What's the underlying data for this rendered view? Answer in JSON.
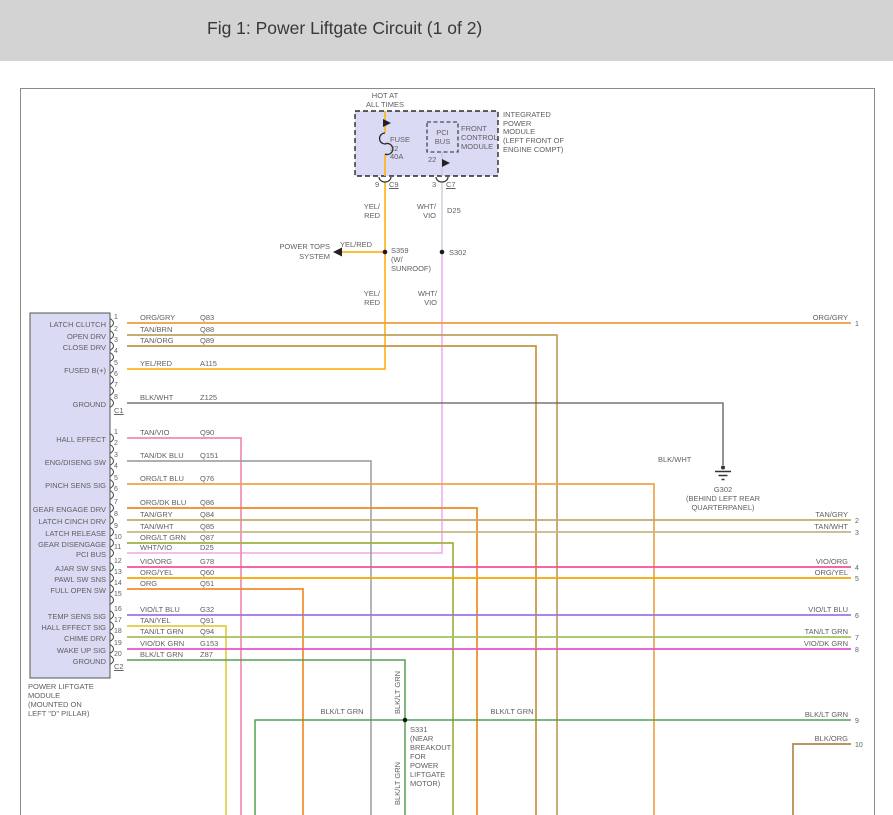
{
  "title": "Fig 1: Power Liftgate Circuit (1 of 2)",
  "colors": {
    "title_bar_bg": "#d3d3d3",
    "module_fill": "#dadaf4",
    "diagram_border": "#8a8a8a",
    "label_text": "#606060",
    "symbol_black": "#2b2b2b"
  },
  "wire_colors": {
    "ORG/GRY": "#F09C3C",
    "TAN/BRN": "#BFA05E",
    "TAN/ORG": "#C89440",
    "YEL/RED": "#FFB41E",
    "BLK/WHT": "#5C5C5C",
    "WHT/VIO_TOP": "#C9C9DB",
    "WHT/VIO": "#F2B4EC",
    "TAN/VIO": "#F08CB4",
    "TAN/DK BLU": "#9097A0",
    "ORG/LT BLU": "#F0A44C",
    "ORG/DK BLU": "#ED8A1F",
    "TAN/GRY": "#BCAD72",
    "TAN/WHT": "#C7B686",
    "ORG/LT GRN": "#9DB33F",
    "VIO/ORG": "#F24FA0",
    "ORG/YEL": "#F5A500",
    "ORG": "#F28C28",
    "VIO/LT BLU": "#9B72E8",
    "TAN/YEL": "#E3CC3E",
    "TAN/LT GRN": "#A4C05E",
    "VIO/DK GRN": "#E654C8",
    "BLK/LT GRN": "#55A055",
    "BLK/ORG": "#B5854C"
  },
  "ipm": {
    "hot_label": [
      "HOT AT",
      "ALL TIMES"
    ],
    "fuse": [
      "FUSE",
      "32",
      "40A"
    ],
    "pci_bus": [
      "PCI",
      "BUS"
    ],
    "front_control_module": [
      "FRONT",
      "CONTROL",
      "MODULE"
    ],
    "name": [
      "INTEGRATED",
      "POWER",
      "MODULE",
      "(LEFT FRONT OF",
      "ENGINE COMPT)"
    ],
    "pin22": "22",
    "pin9": "9",
    "conn_c9": "C9",
    "pin3": "3",
    "conn_c7": "C7"
  },
  "top_labels": {
    "yel_red_1": [
      "YEL/",
      "RED"
    ],
    "wht_vio_1": [
      "WHT/",
      "VIO"
    ],
    "d25": "D25",
    "yel_red_2": [
      "YEL/",
      "RED"
    ],
    "wht_vio_2": [
      "WHT/",
      "VIO"
    ],
    "power_tops_wire": "YEL/RED"
  },
  "power_tops": {
    "label": [
      "POWER TOPS",
      "SYSTEM"
    ]
  },
  "splices": {
    "s359": [
      "S359",
      "(W/",
      "SUNROOF)"
    ],
    "s302": "S302",
    "s331": [
      "S331",
      "(NEAR",
      "BREAKOUT",
      "FOR",
      "POWER",
      "LIFTGATE",
      "MOTOR)"
    ]
  },
  "grounds": {
    "blk_wht_label": "BLK/WHT",
    "g302": [
      "G302",
      "(BEHIND LEFT REAR",
      "QUARTERPANEL)"
    ]
  },
  "mid_labels": {
    "blk_lt_grn": "BLK/LT GRN"
  },
  "liftgate_module": {
    "caption": [
      "POWER LIFTGATE",
      "MODULE",
      "(MOUNTED ON",
      "LEFT \"D\" PILLAR)"
    ],
    "c1": {
      "name": "C1",
      "pins": [
        {
          "pin": "1",
          "label": "LATCH CLUTCH",
          "wire": "ORG/GRY",
          "circuit": "Q83"
        },
        {
          "pin": "2",
          "label": "OPEN DRV",
          "wire": "TAN/BRN",
          "circuit": "Q88"
        },
        {
          "pin": "3",
          "label": "CLOSE DRV",
          "wire": "TAN/ORG",
          "circuit": "Q89"
        },
        {
          "pin": "4",
          "label": "",
          "wire": "",
          "circuit": ""
        },
        {
          "pin": "5",
          "label": "FUSED B(+)",
          "wire": "YEL/RED",
          "circuit": "A115"
        },
        {
          "pin": "6",
          "label": "",
          "wire": "",
          "circuit": ""
        },
        {
          "pin": "7",
          "label": "",
          "wire": "",
          "circuit": ""
        },
        {
          "pin": "8",
          "label": "GROUND",
          "wire": "BLK/WHT",
          "circuit": "Z125"
        }
      ]
    },
    "c2": {
      "name": "C2",
      "pins": [
        {
          "pin": "1",
          "label": "HALL EFFECT",
          "wire": "TAN/VIO",
          "circuit": "Q90"
        },
        {
          "pin": "2",
          "label": "",
          "wire": "",
          "circuit": ""
        },
        {
          "pin": "3",
          "label": "ENG/DISENG SW",
          "wire": "TAN/DK BLU",
          "circuit": "Q151"
        },
        {
          "pin": "4",
          "label": "",
          "wire": "",
          "circuit": ""
        },
        {
          "pin": "5",
          "label": "PINCH SENS SIG",
          "wire": "ORG/LT BLU",
          "circuit": "Q76"
        },
        {
          "pin": "6",
          "label": "",
          "wire": "",
          "circuit": ""
        },
        {
          "pin": "7",
          "label": "GEAR ENGAGE DRV",
          "wire": "ORG/DK BLU",
          "circuit": "Q86"
        },
        {
          "pin": "8",
          "label": "LATCH CINCH DRV",
          "wire": "TAN/GRY",
          "circuit": "Q84"
        },
        {
          "pin": "9",
          "label": "LATCH RELEASE",
          "wire": "TAN/WHT",
          "circuit": "Q85"
        },
        {
          "pin": "10",
          "label": "GEAR DISENGAGE",
          "wire": "ORG/LT GRN",
          "circuit": "Q87"
        },
        {
          "pin": "11",
          "label": "PCI BUS",
          "wire": "WHT/VIO",
          "circuit": "D25"
        },
        {
          "pin": "12",
          "label": "AJAR SW SNS",
          "wire": "VIO/ORG",
          "circuit": "G78"
        },
        {
          "pin": "13",
          "label": "PAWL SW SNS",
          "wire": "ORG/YEL",
          "circuit": "Q60"
        },
        {
          "pin": "14",
          "label": "FULL OPEN SW",
          "wire": "ORG",
          "circuit": "Q51"
        },
        {
          "pin": "15",
          "label": "",
          "wire": "",
          "circuit": ""
        },
        {
          "pin": "16",
          "label": "TEMP SENS SIG",
          "wire": "VIO/LT BLU",
          "circuit": "G32"
        },
        {
          "pin": "17",
          "label": "HALL EFFECT SIG",
          "wire": "TAN/YEL",
          "circuit": "Q91"
        },
        {
          "pin": "18",
          "label": "CHIME DRV",
          "wire": "TAN/LT GRN",
          "circuit": "Q94"
        },
        {
          "pin": "19",
          "label": "WAKE UP SIG",
          "wire": "VIO/DK GRN",
          "circuit": "G153"
        },
        {
          "pin": "20",
          "label": "GROUND",
          "wire": "BLK/LT GRN",
          "circuit": "Z87"
        }
      ]
    }
  },
  "right_edge": [
    {
      "num": "1",
      "wire": "ORG/GRY"
    },
    {
      "num": "2",
      "wire": "TAN/GRY"
    },
    {
      "num": "3",
      "wire": "TAN/WHT"
    },
    {
      "num": "4",
      "wire": "VIO/ORG"
    },
    {
      "num": "5",
      "wire": "ORG/YEL"
    },
    {
      "num": "6",
      "wire": "VIO/LT BLU"
    },
    {
      "num": "7",
      "wire": "TAN/LT GRN"
    },
    {
      "num": "8",
      "wire": "VIO/DK GRN"
    },
    {
      "num": "9",
      "wire": "BLK/LT GRN"
    },
    {
      "num": "10",
      "wire": "BLK/ORG"
    }
  ]
}
